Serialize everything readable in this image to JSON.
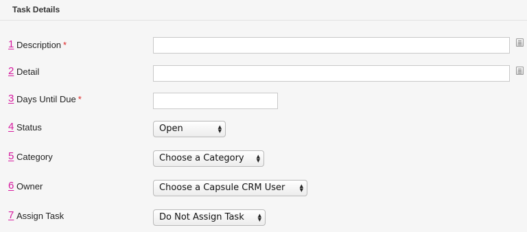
{
  "section": {
    "title": "Task Details"
  },
  "fields": {
    "description": {
      "num": "1",
      "label": "Description",
      "required_mark": "*",
      "value": ""
    },
    "detail": {
      "num": "2",
      "label": "Detail",
      "value": ""
    },
    "days_until_due": {
      "num": "3",
      "label": "Days Until Due",
      "required_mark": "*",
      "value": ""
    },
    "status": {
      "num": "4",
      "label": "Status",
      "selected": "Open"
    },
    "category": {
      "num": "5",
      "label": "Category",
      "selected": "Choose a Category"
    },
    "owner": {
      "num": "6",
      "label": "Owner",
      "selected": "Choose a Capsule CRM User"
    },
    "assign_task": {
      "num": "7",
      "label": "Assign Task",
      "selected": "Do Not Assign Task"
    }
  },
  "icons": {
    "memo": "memo-expand-icon",
    "select_arrow": "updown-chevron-icon"
  },
  "colors": {
    "annotation": "#d6189e",
    "required": "#dd2222"
  }
}
